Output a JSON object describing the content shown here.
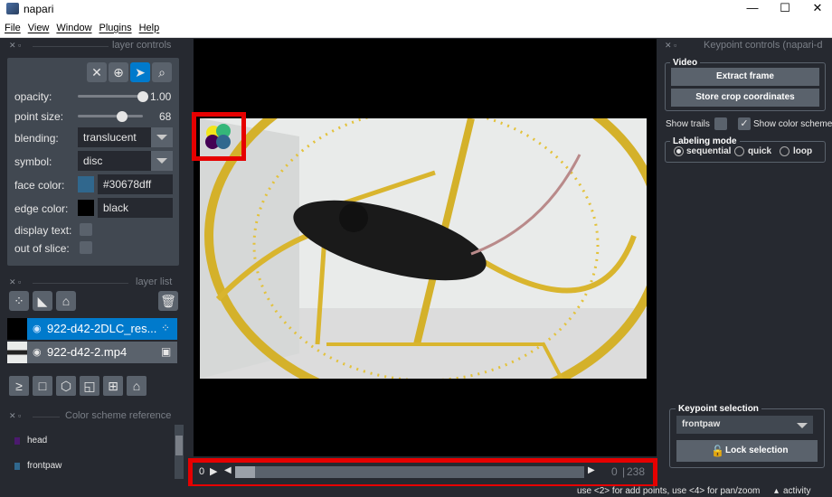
{
  "window": {
    "title": "napari"
  },
  "menu": [
    "File",
    "View",
    "Window",
    "Plugins",
    "Help"
  ],
  "layer_controls": {
    "dock_title": "layer controls",
    "opacity_label": "opacity:",
    "opacity_value": "1.00",
    "opacity_fraction": 1.0,
    "point_size_label": "point size:",
    "point_size_value": "68",
    "blending_label": "blending:",
    "blending_value": "translucent",
    "symbol_label": "symbol:",
    "symbol_value": "disc",
    "face_color_label": "face color:",
    "face_color_value": "#30678dff",
    "face_color_swatch": "#30678d",
    "edge_color_label": "edge color:",
    "edge_color_value": "black",
    "edge_color_swatch": "#000000",
    "display_text_label": "display text:",
    "out_of_slice_label": "out of slice:"
  },
  "layer_list": {
    "dock_title": "layer list",
    "layers": [
      {
        "name": "922-d42-2DLC_res...",
        "selected": true,
        "type_icon": "points-icon"
      },
      {
        "name": "922-d42-2.mp4",
        "selected": false,
        "type_icon": "image-icon"
      }
    ]
  },
  "color_scheme_ref": {
    "dock_title": "Color scheme reference",
    "items": [
      {
        "label": "head",
        "color": "#4b1a6e"
      },
      {
        "label": "frontpaw",
        "color": "#30678d"
      }
    ]
  },
  "keypoint_controls": {
    "dock_title": "Keypoint controls (napari-d",
    "video_group": "Video",
    "extract_frame": "Extract frame",
    "store_crop": "Store crop coordinates",
    "show_trails": "Show trails",
    "show_color_scheme": "Show color scheme",
    "labeling_mode_group": "Labeling mode",
    "modes": [
      "sequential",
      "quick",
      "loop"
    ],
    "selected_mode": "sequential",
    "keypoint_selection_group": "Keypoint selection",
    "keypoint_value": "frontpaw",
    "lock_selection": "Lock selection"
  },
  "dims": {
    "current": "0",
    "frame_display": "0",
    "max_display": "238",
    "play_label": "0"
  },
  "status": {
    "hint": "use <2> for add points, use <4> for pan/zoom",
    "activity": "activity"
  },
  "colors": {
    "accent": "#007acc",
    "highlight_red": "#e60000",
    "panel_bg": "#262930"
  }
}
